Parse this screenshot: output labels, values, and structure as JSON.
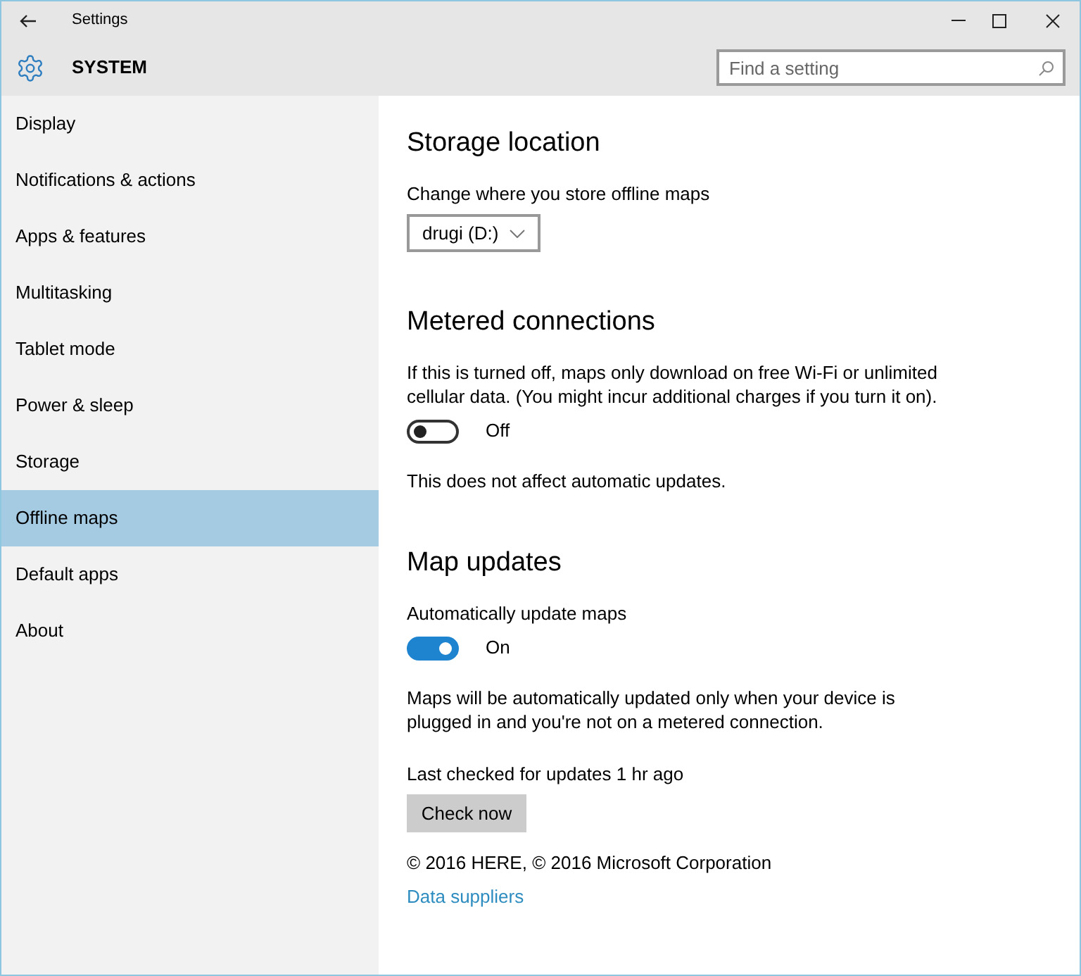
{
  "window": {
    "title": "Settings"
  },
  "header": {
    "title": "SYSTEM",
    "search": {
      "placeholder": "Find a setting"
    }
  },
  "sidebar": {
    "items": [
      {
        "label": "Display",
        "selected": false
      },
      {
        "label": "Notifications & actions",
        "selected": false
      },
      {
        "label": "Apps & features",
        "selected": false
      },
      {
        "label": "Multitasking",
        "selected": false
      },
      {
        "label": "Tablet mode",
        "selected": false
      },
      {
        "label": "Power & sleep",
        "selected": false
      },
      {
        "label": "Storage",
        "selected": false
      },
      {
        "label": "Offline maps",
        "selected": true
      },
      {
        "label": "Default apps",
        "selected": false
      },
      {
        "label": "About",
        "selected": false
      }
    ]
  },
  "sections": [
    {
      "heading": "Storage location",
      "items": [
        {
          "kind": "label",
          "text": "Change where you store offline maps"
        },
        {
          "kind": "dropdown",
          "value": "drugi (D:)"
        }
      ]
    },
    {
      "heading": "Metered connections",
      "items": [
        {
          "kind": "paragraph",
          "text": "If this is turned off, maps only download on free Wi-Fi or unlimited cellular data. (You might incur additional charges if you turn it on)."
        },
        {
          "kind": "toggle",
          "on": false,
          "state_label": "Off"
        },
        {
          "kind": "paragraph",
          "text": "This does not affect automatic updates."
        }
      ]
    },
    {
      "heading": "Map updates",
      "items": [
        {
          "kind": "label",
          "text": "Automatically update maps"
        },
        {
          "kind": "toggle",
          "on": true,
          "state_label": "On"
        },
        {
          "kind": "paragraph",
          "text": "Maps will be automatically updated only when your device is plugged in and you're not on a metered connection."
        },
        {
          "kind": "status",
          "text": "Last checked for updates 1 hr ago"
        },
        {
          "kind": "button",
          "label": "Check now"
        },
        {
          "kind": "copyright",
          "text": "© 2016 HERE, © 2016 Microsoft Corporation"
        },
        {
          "kind": "link",
          "text": "Data suppliers"
        }
      ]
    }
  ]
}
